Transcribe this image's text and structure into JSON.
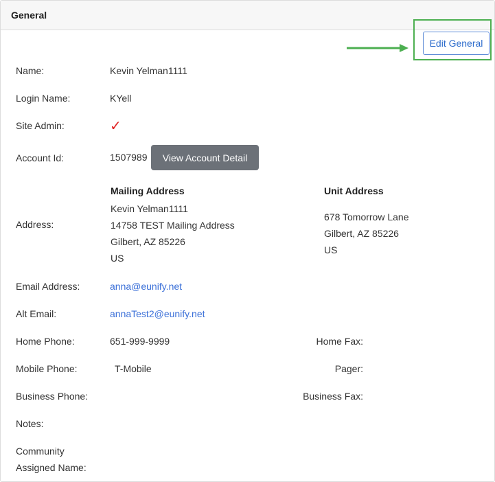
{
  "panel": {
    "title": "General"
  },
  "actions": {
    "edit_label": "Edit General",
    "view_account_label": "View Account Detail"
  },
  "labels": {
    "name": "Name:",
    "login_name": "Login Name:",
    "site_admin": "Site Admin:",
    "account_id": "Account Id:",
    "address": "Address:",
    "email": "Email Address:",
    "alt_email": "Alt Email:",
    "home_phone": "Home Phone:",
    "home_fax": "Home Fax:",
    "mobile_phone": "Mobile Phone:",
    "pager": "Pager:",
    "business_phone": "Business Phone:",
    "business_fax": "Business Fax:",
    "notes": "Notes:",
    "community_line1": "Community",
    "community_line2": "Assigned Name:"
  },
  "values": {
    "name": "Kevin Yelman1111",
    "login_name": "KYell",
    "site_admin_mark": "✓",
    "account_id": "1507989",
    "email": "anna@eunify.net",
    "alt_email": "annaTest2@eunify.net",
    "home_phone": "651-999-9999",
    "mobile_phone": "T-Mobile"
  },
  "mailing_address": {
    "title": "Mailing Address",
    "lines": [
      "Kevin Yelman1111",
      "14758 TEST Mailing Address",
      "Gilbert, AZ 85226",
      "US"
    ]
  },
  "unit_address": {
    "title": "Unit Address",
    "lines": [
      "678 Tomorrow Lane",
      "Gilbert, AZ 85226",
      "US"
    ]
  },
  "colors": {
    "highlight": "#4caf50",
    "link": "#3a6fd8",
    "check": "#e02020",
    "button_bg": "#6c7178"
  },
  "icons": {
    "arrow": "arrow-right-icon",
    "check": "checkmark-icon"
  }
}
